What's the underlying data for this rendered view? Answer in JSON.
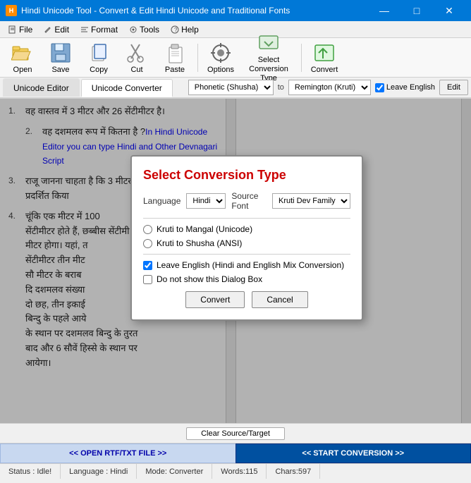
{
  "titlebar": {
    "title": "Hindi Unicode Tool - Convert & Edit Hindi Unicode and Traditional Fonts",
    "icon_label": "H"
  },
  "menubar": {
    "items": [
      {
        "id": "file",
        "label": "File"
      },
      {
        "id": "edit",
        "label": "Edit"
      },
      {
        "id": "format",
        "label": "Format"
      },
      {
        "id": "tools",
        "label": "Tools"
      },
      {
        "id": "help",
        "label": "Help"
      }
    ]
  },
  "toolbar": {
    "open_label": "Open",
    "save_label": "Save",
    "copy_label": "Copy",
    "cut_label": "Cut",
    "paste_label": "Paste",
    "options_label": "Options",
    "select_conversion_label": "Select Conversion Type",
    "convert_label": "Convert"
  },
  "tabs": {
    "unicode_editor": "Unicode Editor",
    "unicode_converter": "Unicode Converter",
    "active": "unicode_converter"
  },
  "converter_bar": {
    "from_label": "Phonetic (Shusha)",
    "arrow": "to",
    "to_label": "Remington (Kruti)",
    "leave_english_label": "Leave English",
    "leave_english_checked": true,
    "edit_label": "Edit"
  },
  "editor": {
    "lines": [
      {
        "num": "1.",
        "text": "वह वास्तव में 3 मीटर और 26 सेंटीमीटर है।"
      },
      {
        "num": "2.",
        "text": "वह दशमलव रूप में कितना है ?",
        "extra": "In Hindi Unicode Editor you can type Hindi and Other Devnagari Script"
      },
      {
        "num": "3.",
        "text": "राजू जानना चाहता है कि 3 मीटर 26 सेंटीमीटर को दशम..."
      },
      {
        "num": "4.",
        "text": "चूंकि एक मीटर में 100 सेंटीमीटर होते हैं, छब्बीस सेंटीमी..."
      }
    ]
  },
  "bottom": {
    "clear_btn": "Clear Source/Target",
    "open_rtf_btn": "<< OPEN RTF/TXT FILE >>",
    "start_conversion_btn": "<< START CONVERSION >>"
  },
  "statusbar": {
    "status": "Status : Idle!",
    "language": "Language : Hindi",
    "mode": "Mode: Converter",
    "words": "Words:115",
    "chars": "Chars:597"
  },
  "modal": {
    "title": "Select Conversion Type",
    "language_label": "Language",
    "language_value": "Hindi",
    "source_font_label": "Source Font",
    "source_font_value": "Kruti Dev Family",
    "radio1": "Kruti to Mangal (Unicode)",
    "radio2": "Kruti to Shusha (ANSI)",
    "cb1_label": "Leave English (Hindi and English Mix Conversion)",
    "cb1_checked": true,
    "cb2_label": "Do not show this Dialog Box",
    "cb2_checked": false,
    "convert_btn": "Convert",
    "cancel_btn": "Cancel"
  },
  "colors": {
    "accent_blue": "#0050a0",
    "title_red": "#cc0000",
    "tab_active": "white",
    "bottom_right_bg": "#0050a0"
  }
}
